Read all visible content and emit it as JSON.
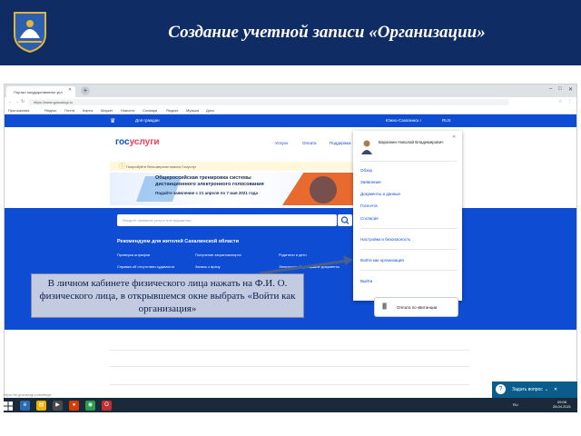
{
  "slide": {
    "title": "Создание учетной записи «Организации»"
  },
  "browser": {
    "tab_title": "Портал государственных усл",
    "url": "https://www.gosuslugi.ru",
    "bookmarks": [
      "Приложения",
      "Яндекс",
      "Почта",
      "Карты",
      "Маркет",
      "Новости",
      "Словари",
      "Яндекс",
      "Музыка",
      "Диск"
    ],
    "status_text": "https://lk.gosuslugi.ru/settings"
  },
  "site": {
    "topbar_left": "Для граждан",
    "topbar_region": "Южно-Сахалинск г",
    "topbar_lang": "RUS",
    "logo_gos": "гос",
    "logo_uslugi": "услуги",
    "nav": [
      "Услуги",
      "Оплата",
      "Поддержка"
    ],
    "notice": "Попробуйте бета-версию нового Госуслуг",
    "banner_title": "Общероссийская тренировка системы дистанционного электронного голосования",
    "banner_sub": "Подайте заявление с 21 апреля по 7 мая 2021 года",
    "search_placeholder": "Введите название услуги или ведомства",
    "recs_title": "Рекомендуем для жителей Сахалинской области",
    "recs": [
      "Проверка штрафов",
      "Получение загранпаспорта",
      "Родители и дети",
      "Справка об отсутствии судимости",
      "Запись к врачу",
      "Электронный дневник",
      "Прочие документы"
    ],
    "payment_button": "Оплата по квитанции"
  },
  "dropdown": {
    "user_name": "Варанкин Николай Владимирович",
    "items": [
      "Обзор",
      "Заявления",
      "Документы и данные",
      "Госпочта",
      "Согласия"
    ],
    "settings": "Настройки и безопасность",
    "login_org": "Войти как организация",
    "logout": "Выйти"
  },
  "callout": {
    "text": "В личном кабинете физического лица нажать на Ф.И. О. физического лица, в открывшемся окне выбрать «Войти как организация»"
  },
  "chat": {
    "label": "Задать вопрос"
  },
  "taskbar": {
    "time": "09:06",
    "date": "28.04.2021",
    "lang": "RU"
  },
  "colors": {
    "header_bg": "#0f2d64",
    "gos_blue": "#0d4cd3",
    "gos_red": "#ee3f58",
    "callout_bg": "#c3cbe1"
  }
}
